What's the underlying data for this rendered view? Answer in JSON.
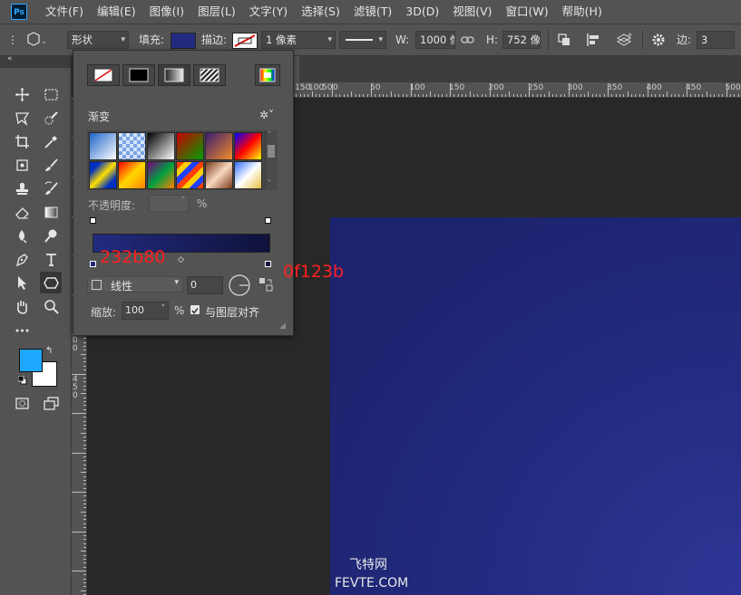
{
  "app": {
    "logo_text": "Ps"
  },
  "menu": {
    "items": [
      "文件(F)",
      "编辑(E)",
      "图像(I)",
      "图层(L)",
      "文字(Y)",
      "选择(S)",
      "滤镜(T)",
      "3D(D)",
      "视图(V)",
      "窗口(W)",
      "帮助(H)"
    ]
  },
  "options": {
    "mode": "形状",
    "fill_label": "填充:",
    "fill_color": "#232b80",
    "stroke_label": "描边:",
    "stroke_width": "1 像素",
    "w_label": "W:",
    "w_value": "1000 像",
    "h_label": "H:",
    "h_value": "752 像",
    "sides_label": "边:",
    "sides_value": "3"
  },
  "ruler": {
    "h_labels": [
      "50",
      "100",
      "150",
      "200",
      "250",
      "300",
      "350",
      "400",
      "450",
      "500"
    ],
    "h_labels_left": [
      "150",
      "100",
      "50",
      "0"
    ],
    "v_labels": [
      "1\n5\n0",
      "2\n0\n0",
      "2\n5\n0",
      "3\n0\n0",
      "3\n5\n0",
      "4\n0\n0",
      "4\n5\n0"
    ]
  },
  "panel": {
    "section_title": "渐变",
    "opacity_label": "不透明度:",
    "opacity_value": "",
    "percent": "%",
    "type_value": "线性",
    "angle_value": "0",
    "scale_label": "缩放:",
    "scale_value": "100",
    "scale_percent": "%",
    "align_label": "与图层对齐",
    "align_checked": true,
    "swatches": [
      "linear-gradient(135deg,#1e64c8,#ffffff)",
      "repeating-conic-gradient(#7aa4e6 0 25%,#d8e4f8 0 50%) 0 0/8px 8px",
      "linear-gradient(135deg,#000,#fff)",
      "linear-gradient(135deg,#c80000,#00a000)",
      "linear-gradient(135deg,#3a1c70,#f28c28)",
      "linear-gradient(135deg,#0000ff,#ff0000,#ffff00)",
      "linear-gradient(135deg,#0030c0 20%,#ffe000 50%,#0030c0 80%)",
      "linear-gradient(135deg,#ff0000,#ffd800,#ff8000)",
      "linear-gradient(135deg,#7a0080,#00a040,#ff8000)",
      "repeating-linear-gradient(135deg,#ff4000 0 6px,#ffd000 6px 12px,#2040ff 12px 18px)",
      "linear-gradient(135deg,#7a3a1a,#f8d8c0,#7a3a1a)",
      "linear-gradient(135deg,#3070ff,#ffffff,#e8c040)"
    ]
  },
  "annotations": {
    "left_color": "232b80",
    "right_color": "0f123b"
  },
  "watermark": {
    "line1": "飞特网",
    "line2": "FEVTE.COM"
  },
  "colors": {
    "foreground": "#1ea7ff",
    "background": "#ffffff",
    "gradient_start": "#232b80",
    "gradient_end": "#0f123b"
  }
}
